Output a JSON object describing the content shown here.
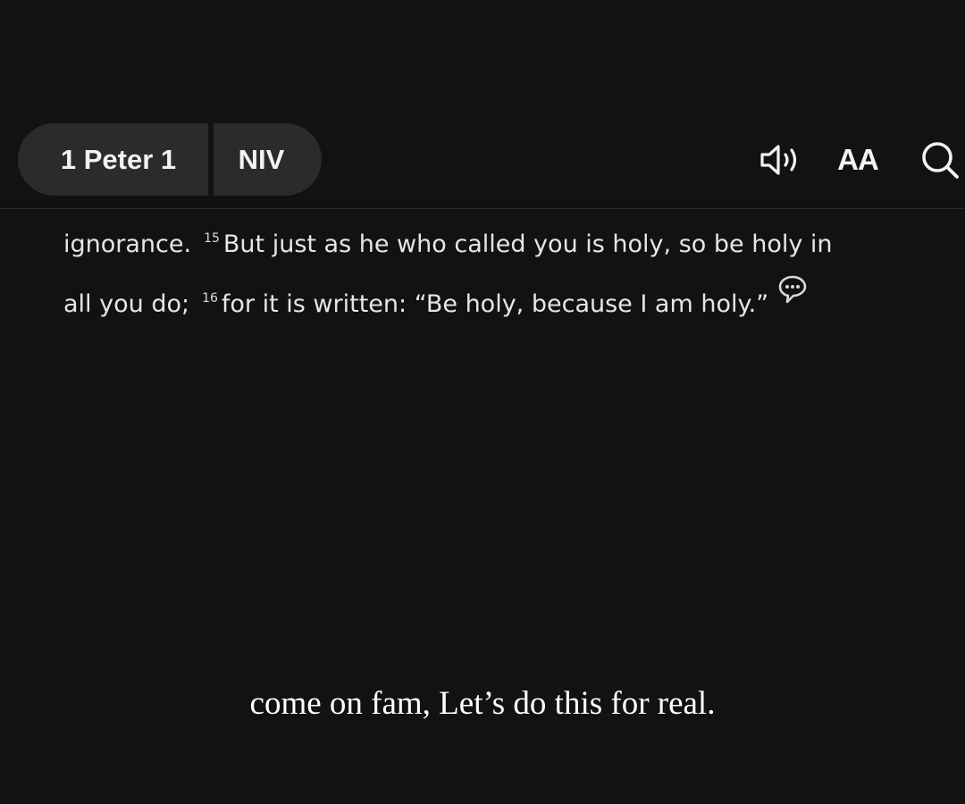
{
  "header": {
    "book_chapter": "1 Peter 1",
    "version": "NIV",
    "audio_icon": "speaker-icon",
    "font_size_label": "AA",
    "search_icon": "search-icon"
  },
  "passage": {
    "line1_start": "ignorance.",
    "verse15_number": "15",
    "verse15_text": "But just as he who called you is holy, so be holy in",
    "line2_start": "all you do;",
    "verse16_number": "16",
    "verse16_text": "for it is written: “Be holy, because I am holy.”",
    "note_icon": "speech-bubble-note-icon"
  },
  "caption": {
    "text": "come on fam, Let’s do this for real."
  }
}
